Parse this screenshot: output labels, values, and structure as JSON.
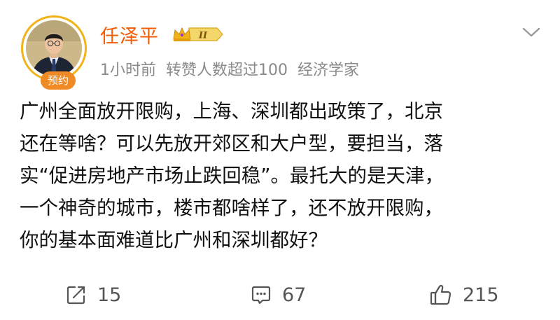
{
  "post": {
    "author": {
      "name": "任泽平",
      "avatar_badge": "预约",
      "level_badge": "II"
    },
    "meta": {
      "time": "1小时前",
      "reposts_note": "转赞人数超过100",
      "title": "经济学家"
    },
    "lines": [
      "广州全面放开限购，上海、深圳都出政策了，北京",
      "还在等啥？可以先放开郊区和大户型，要担当，落",
      "实“促进房地产市场止跌回稳”。最托大的是天津，",
      "一个神奇的城市，楼市都啥样了，还不放开限购，",
      "你的基本面难道比广州和深圳都好？"
    ],
    "actions": {
      "repost_count": "15",
      "comment_count": "67",
      "like_count": "215"
    }
  },
  "icons": {
    "repost": "share-icon",
    "comment": "comment-icon",
    "like": "thumbs-up-icon",
    "more": "chevron-down-icon",
    "level": "crown-icon"
  },
  "colors": {
    "username": "#f25c05",
    "badge_orange": "#f08a24",
    "ring_gold": "#f2b318",
    "meta_gray": "#8a8a8a",
    "icon_gray": "#555555"
  }
}
